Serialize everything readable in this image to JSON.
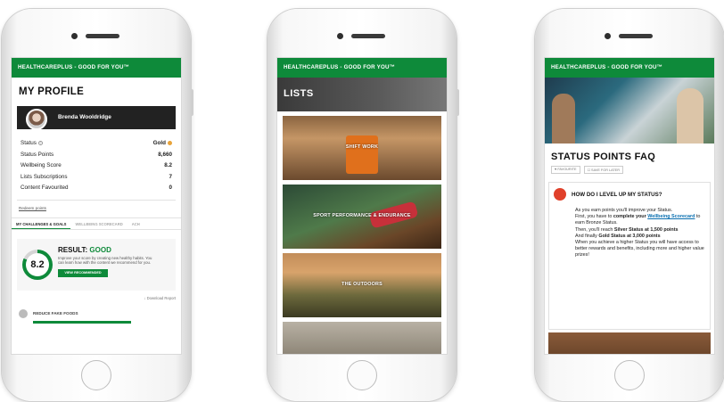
{
  "app_bar": {
    "title": "HEALTHCAREPLUS - GOOD FOR YOU™"
  },
  "profile_screen": {
    "title": "MY PROFILE",
    "user_name": "Brenda Wooldridge",
    "stats": [
      {
        "label": "Status",
        "value": "Gold"
      },
      {
        "label": "Status Points",
        "value": "8,660"
      },
      {
        "label": "Wellbeing Score",
        "value": "8.2"
      },
      {
        "label": "Lists Subscriptions",
        "value": "7"
      },
      {
        "label": "Content Favourited",
        "value": "0"
      }
    ],
    "link": "Redeem points",
    "tabs": [
      "MY CHALLENGES & GOALS",
      "WELLBEING SCORECARD",
      "ACH"
    ],
    "result": {
      "score": "8.2",
      "score_fraction": 0.82,
      "heading": "RESULT:",
      "heading_value": "GOOD",
      "text": "Improve your score by creating new healthy habits. You can learn how with the content we recommend for you.",
      "button": "VIEW RECOMMENDED"
    },
    "download": "Download Report",
    "goal_item": "REDUCE FAKE FOODS"
  },
  "lists_screen": {
    "title": "LISTS",
    "tiles": [
      "SHIFT WORK",
      "SPORT PERFORMANCE & ENDURANCE",
      "THE OUTDOORS"
    ]
  },
  "faq_screen": {
    "title": "STATUS POINTS FAQ",
    "tags": [
      "FAVOURITE",
      "SAVE FOR LATER"
    ],
    "question": "HOW DO I LEVEL UP MY STATUS?",
    "answer": {
      "p1": "As you earn points you'll improve your Status.",
      "p2a": "First, you have to ",
      "p2b": "complete your",
      "p2link": "Wellbeing Scorecard",
      "p2c": " to earn Bronze Status.",
      "p3a": "Then, you'll reach ",
      "p3b": "Silver Status at 1,500 points",
      "p4a": "And finally ",
      "p4b": "Gold Status at 3,000 points",
      "p5": "When you achieve a higher Status you will have access to better rewards and benefits, including more and higher value prizes!"
    }
  },
  "colors": {
    "brand_green": "#0e8a3a",
    "gold": "#e8a33a",
    "faq_icon": "#e0402a"
  }
}
